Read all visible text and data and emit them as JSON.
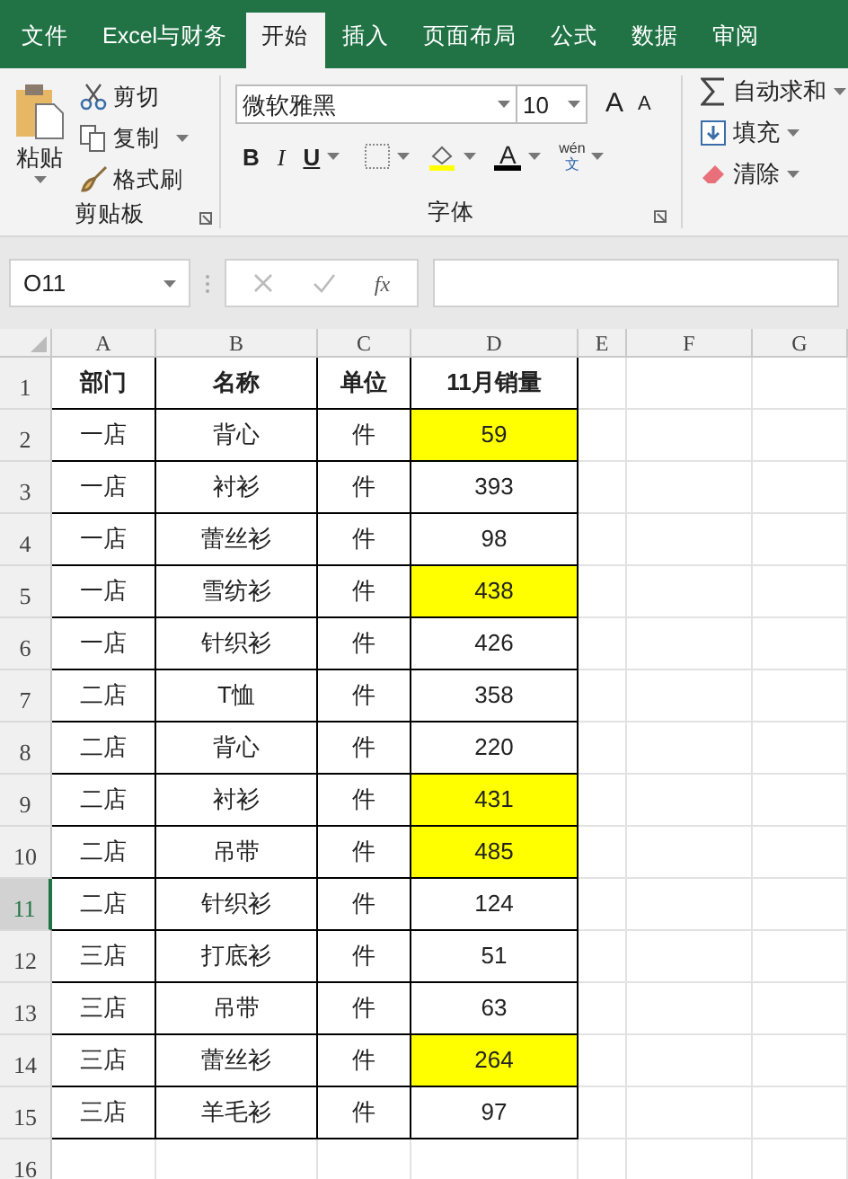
{
  "tabs": [
    {
      "label": "文件",
      "selected": false
    },
    {
      "label": "Excel与财务",
      "selected": false
    },
    {
      "label": "开始",
      "selected": true
    },
    {
      "label": "插入",
      "selected": false
    },
    {
      "label": "页面布局",
      "selected": false
    },
    {
      "label": "公式",
      "selected": false
    },
    {
      "label": "数据",
      "selected": false
    },
    {
      "label": "审阅",
      "selected": false
    }
  ],
  "clipboard": {
    "paste": "粘贴",
    "cut": "剪切",
    "copy": "复制",
    "format_painter": "格式刷",
    "label": "剪贴板"
  },
  "font": {
    "name": "微软雅黑",
    "size": "10",
    "grow": "A",
    "shrink": "A",
    "bold": "B",
    "italic": "I",
    "underline": "U",
    "font_color": "A",
    "phonetic_top": "wén",
    "phonetic_bottom": "文",
    "label": "字体"
  },
  "editing": {
    "autosum": "自动求和",
    "fill": "填充",
    "clear": "清除"
  },
  "name_box": "O11",
  "formula_icon": "fx",
  "columns": [
    {
      "label": "A"
    },
    {
      "label": "B"
    },
    {
      "label": "C"
    },
    {
      "label": "D"
    },
    {
      "label": "E"
    },
    {
      "label": "F"
    },
    {
      "label": "G"
    }
  ],
  "header_row": {
    "num": "1",
    "selected": false,
    "cells": [
      "部门",
      "名称",
      "单位",
      "11月销量"
    ]
  },
  "rows": [
    {
      "num": "2",
      "selected": false,
      "highlighted": true,
      "cells": [
        "一店",
        "背心",
        "件",
        "59"
      ]
    },
    {
      "num": "3",
      "selected": false,
      "highlighted": false,
      "cells": [
        "一店",
        "衬衫",
        "件",
        "393"
      ]
    },
    {
      "num": "4",
      "selected": false,
      "highlighted": false,
      "cells": [
        "一店",
        "蕾丝衫",
        "件",
        "98"
      ]
    },
    {
      "num": "5",
      "selected": false,
      "highlighted": true,
      "cells": [
        "一店",
        "雪纺衫",
        "件",
        "438"
      ]
    },
    {
      "num": "6",
      "selected": false,
      "highlighted": false,
      "cells": [
        "一店",
        "针织衫",
        "件",
        "426"
      ]
    },
    {
      "num": "7",
      "selected": false,
      "highlighted": false,
      "cells": [
        "二店",
        "T恤",
        "件",
        "358"
      ]
    },
    {
      "num": "8",
      "selected": false,
      "highlighted": false,
      "cells": [
        "二店",
        "背心",
        "件",
        "220"
      ]
    },
    {
      "num": "9",
      "selected": false,
      "highlighted": true,
      "cells": [
        "二店",
        "衬衫",
        "件",
        "431"
      ]
    },
    {
      "num": "10",
      "selected": false,
      "highlighted": true,
      "cells": [
        "二店",
        "吊带",
        "件",
        "485"
      ]
    },
    {
      "num": "11",
      "selected": true,
      "highlighted": false,
      "cells": [
        "二店",
        "针织衫",
        "件",
        "124"
      ]
    },
    {
      "num": "12",
      "selected": false,
      "highlighted": false,
      "cells": [
        "三店",
        "打底衫",
        "件",
        "51"
      ]
    },
    {
      "num": "13",
      "selected": false,
      "highlighted": false,
      "cells": [
        "三店",
        "吊带",
        "件",
        "63"
      ]
    },
    {
      "num": "14",
      "selected": false,
      "highlighted": true,
      "cells": [
        "三店",
        "蕾丝衫",
        "件",
        "264"
      ]
    },
    {
      "num": "15",
      "selected": false,
      "highlighted": false,
      "cells": [
        "三店",
        "羊毛衫",
        "件",
        "97"
      ]
    },
    {
      "num": "16",
      "selected": false
    }
  ]
}
